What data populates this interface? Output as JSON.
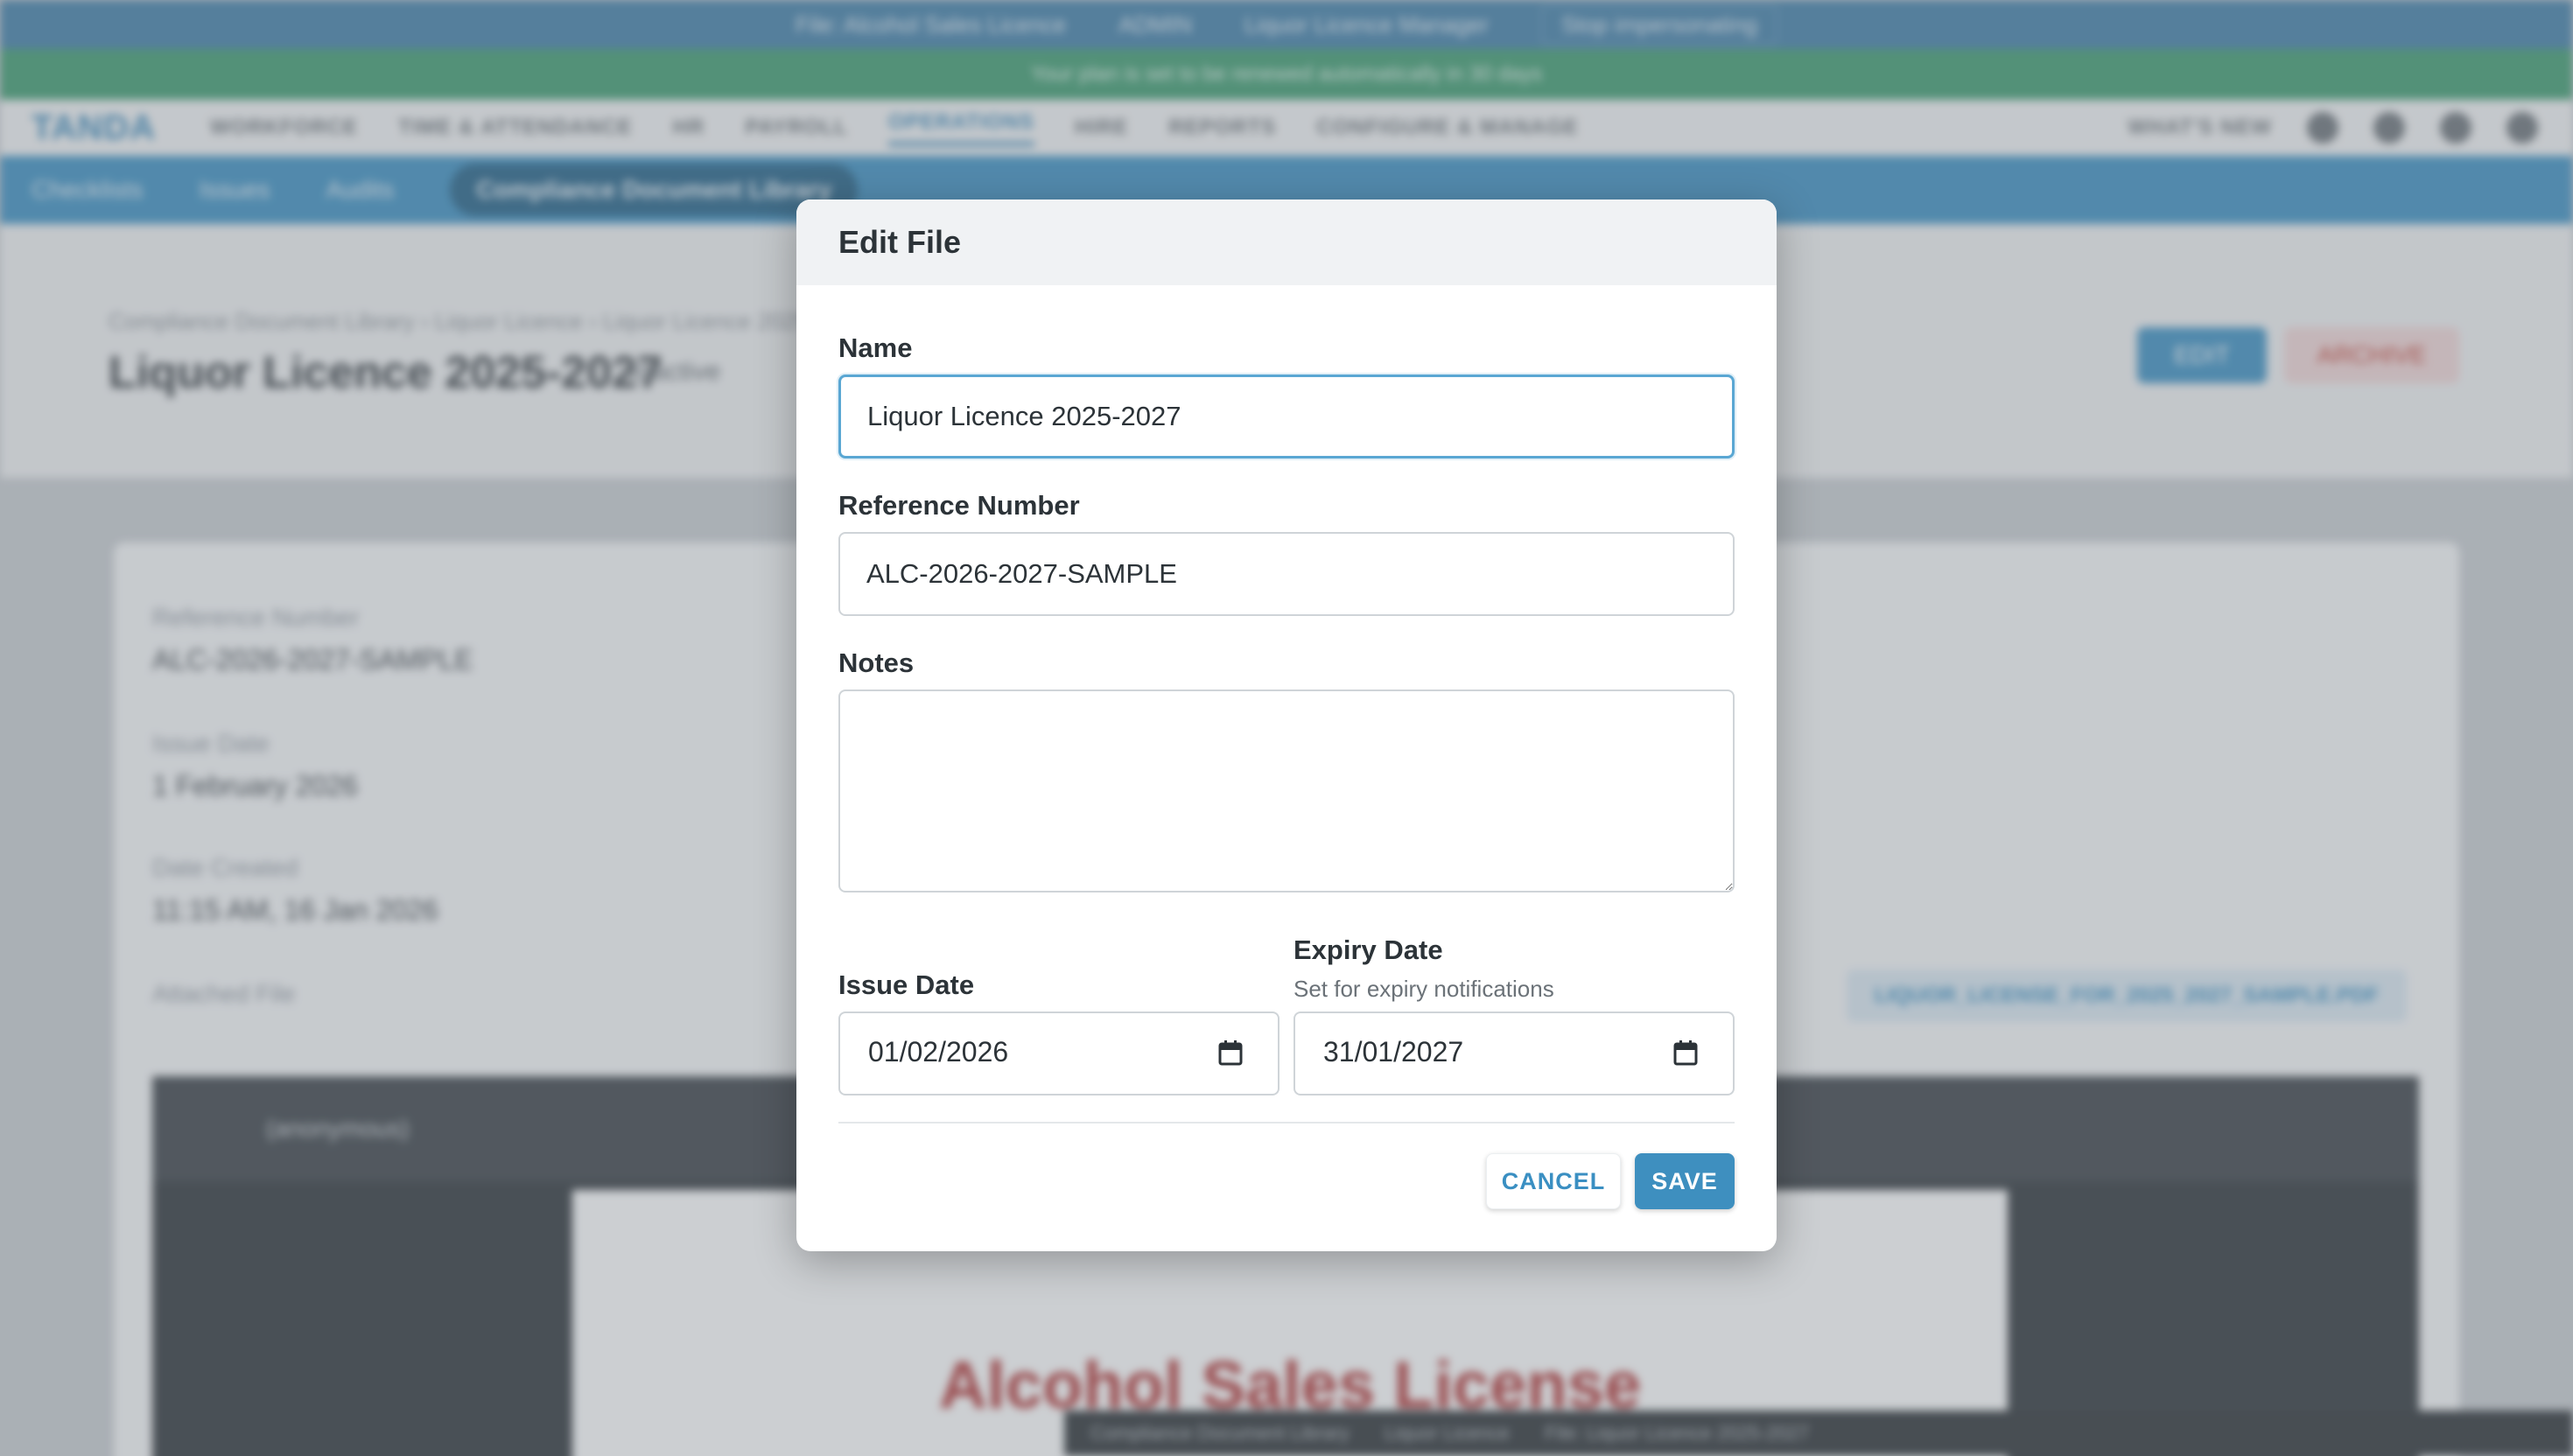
{
  "background": {
    "top_strip": [
      "File: Alcohol Sales Licence",
      "ADMIN",
      "Liquor Licence Manager",
      "Stop impersonating"
    ],
    "banner": "Your plan is set to be renewed automatically in 30 days",
    "nav": {
      "logo": "TANDA",
      "items": [
        "WORKFORCE",
        "TIME & ATTENDANCE",
        "HR",
        "PAYROLL",
        "OPERATIONS",
        "HIRE",
        "REPORTS",
        "CONFIGURE & MANAGE"
      ],
      "active_index": 4,
      "right_label": "WHAT'S NEW"
    },
    "subnav": [
      "Checklists",
      "Issues",
      "Audits",
      "Compliance Document Library"
    ],
    "breadcrumb": "Compliance Document Library  ›  Liquor Licence  ›  Liquor Licence 2025-2027",
    "title": "Liquor Licence 2025-2027",
    "status_tag": "Inactive",
    "edit_label": "EDIT",
    "archive_label": "ARCHIVE",
    "details": [
      {
        "label": "Reference Number",
        "value": "ALC-2026-2027-SAMPLE"
      },
      {
        "label": "Issue Date",
        "value": "1 February 2026"
      },
      {
        "label": "Date Created",
        "value": "11:15 AM, 16 Jan 2026"
      }
    ],
    "attached_label": "Attached File",
    "attached_file": "LIQUOR_LICENSE_FOR_2025_2027_SAMPLE.PDF",
    "viewer_title": "(anonymous)",
    "document_heading": "Alcohol Sales License",
    "status_bar": [
      "Compliance Document Library",
      "Liquor Licence",
      "File: Liquor Licence 2025-2027"
    ]
  },
  "modal": {
    "title": "Edit File",
    "name": {
      "label": "Name",
      "value": "Liquor Licence 2025-2027"
    },
    "reference": {
      "label": "Reference Number",
      "value": "ALC-2026-2027-SAMPLE"
    },
    "notes": {
      "label": "Notes",
      "value": ""
    },
    "issue_date": {
      "label": "Issue Date",
      "value": "01/02/2026"
    },
    "expiry_date": {
      "label": "Expiry Date",
      "hint": "Set for expiry notifications",
      "value": "31/01/2027"
    },
    "cancel_label": "CANCEL",
    "save_label": "SAVE"
  },
  "colors": {
    "accent": "#3e8fbf",
    "focus": "#5aa7d3",
    "banner": "#3c9b6e"
  }
}
